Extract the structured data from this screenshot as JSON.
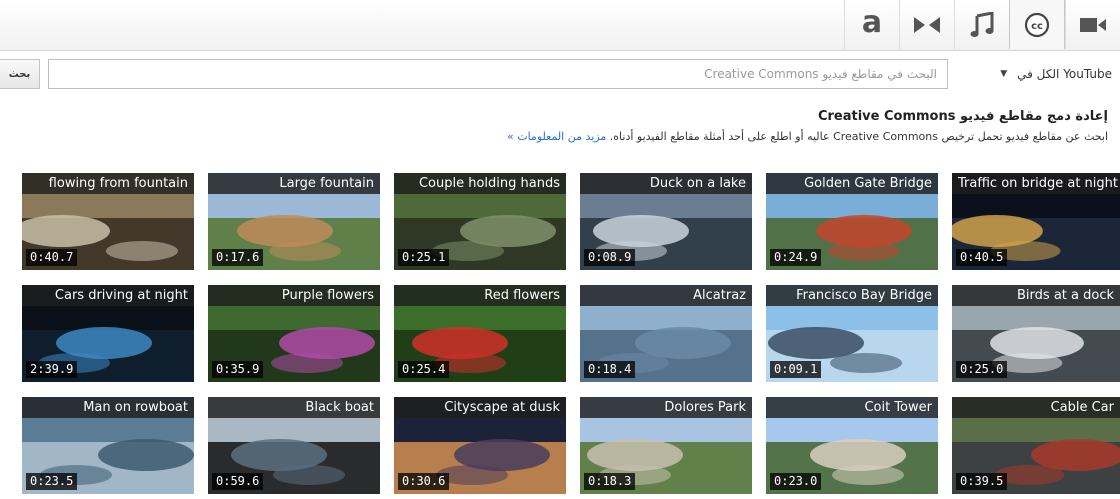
{
  "toolbar": {
    "tabs": [
      {
        "icon": "text-a-icon",
        "label": "a"
      },
      {
        "icon": "transition-icon"
      },
      {
        "icon": "music-note-icon"
      },
      {
        "icon": "creative-commons-icon",
        "label": "cc",
        "active": true
      },
      {
        "icon": "video-camera-icon"
      }
    ]
  },
  "search": {
    "button_label": "بحث",
    "placeholder": "البحث في مقاطع فيديو Creative Commons",
    "scope_label": "الكل في YouTube"
  },
  "header": {
    "title": "إعادة دمج مقاطع فيديو Creative Commons",
    "description": "ابحث عن مقاطع فيديو تحمل ترخيص Creative Commons عاليه أو اطلع على أحد أمثلة مقاطع الفيديو أدناه.",
    "more_link": "مزيد من المعلومات »"
  },
  "videos": [
    {
      "title": "flowing from fountain",
      "duration": "0:40.7",
      "palette": [
        "#8a7a5a",
        "#c8c0a8",
        "#3b3226"
      ]
    },
    {
      "title": "Large fountain",
      "duration": "0:17.6",
      "palette": [
        "#9bb8d6",
        "#c08a5a",
        "#5a7a3a"
      ]
    },
    {
      "title": "Couple holding hands",
      "duration": "0:25.1",
      "palette": [
        "#4d6a38",
        "#7f8f6a",
        "#2b3322"
      ]
    },
    {
      "title": "Duck on a lake",
      "duration": "0:08.9",
      "palette": [
        "#6b7d90",
        "#c9d3dc",
        "#2c3a44"
      ]
    },
    {
      "title": "Golden Gate Bridge",
      "duration": "0:24.9",
      "palette": [
        "#7aaed6",
        "#c2452c",
        "#4c6a3a"
      ]
    },
    {
      "title": "Traffic on bridge at night",
      "duration": "0:40.5",
      "palette": [
        "#0c0f1c",
        "#d0a24a",
        "#1d2a3c"
      ]
    },
    {
      "title": "Cars driving at night",
      "duration": "2:39.9",
      "palette": [
        "#0a1018",
        "#3c88c4",
        "#0e2030"
      ]
    },
    {
      "title": "Purple flowers",
      "duration": "0:35.9",
      "palette": [
        "#3f6a2f",
        "#b04aa8",
        "#1e3418"
      ]
    },
    {
      "title": "Red flowers",
      "duration": "0:25.4",
      "palette": [
        "#3a6e2a",
        "#d0302a",
        "#1f3a14"
      ]
    },
    {
      "title": "Alcatraz",
      "duration": "0:18.4",
      "palette": [
        "#8fb0cc",
        "#6b8aa6",
        "#4e6c85"
      ]
    },
    {
      "title": "Francisco Bay Bridge",
      "duration": "0:09.1",
      "palette": [
        "#8cc0e6",
        "#3a4e60",
        "#bcd8ee"
      ]
    },
    {
      "title": "Birds at a dock",
      "duration": "0:25.0",
      "palette": [
        "#9aa6ae",
        "#dfe3e6",
        "#3a4046"
      ]
    },
    {
      "title": "Man on rowboat",
      "duration": "0:23.5",
      "palette": [
        "#5a7c94",
        "#3c5a70",
        "#a8bccc"
      ]
    },
    {
      "title": "Black boat",
      "duration": "0:59.6",
      "palette": [
        "#aab8c4",
        "#5a6e80",
        "#1c1c1c"
      ]
    },
    {
      "title": "Cityscape at dusk",
      "duration": "0:30.6",
      "palette": [
        "#1c2238",
        "#4a3c5c",
        "#c88a50"
      ]
    },
    {
      "title": "Dolores Park",
      "duration": "0:18.3",
      "palette": [
        "#a8c4e0",
        "#c8c0b0",
        "#5a7a3a"
      ]
    },
    {
      "title": "Coit Tower",
      "duration": "0:23.0",
      "palette": [
        "#a6c8ec",
        "#d8d0c0",
        "#4a6a3a"
      ]
    },
    {
      "title": "Cable Car",
      "duration": "0:39.5",
      "palette": [
        "#5a6e4a",
        "#a83a2a",
        "#3a3c40"
      ]
    }
  ]
}
